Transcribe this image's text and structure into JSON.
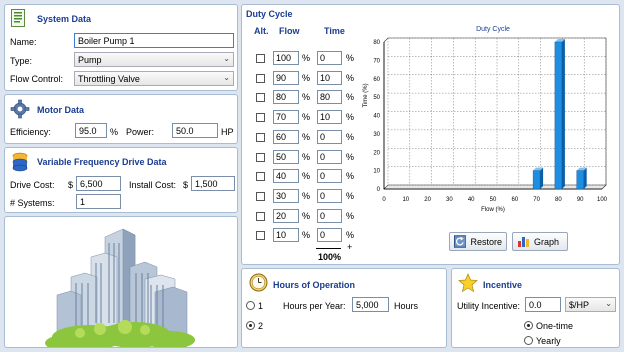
{
  "system": {
    "title": "System Data",
    "name_label": "Name:",
    "name_value": "Boiler Pump 1",
    "type_label": "Type:",
    "type_value": "Pump",
    "flow_control_label": "Flow Control:",
    "flow_control_value": "Throttling Valve"
  },
  "motor": {
    "title": "Motor Data",
    "efficiency_label": "Efficiency:",
    "efficiency_value": "95.0",
    "efficiency_unit": "%",
    "power_label": "Power:",
    "power_value": "50.0",
    "power_unit": "HP"
  },
  "vfd": {
    "title": "Variable Frequency Drive Data",
    "drive_cost_label": "Drive Cost:",
    "drive_cost_currency": "$",
    "drive_cost_value": "6,500",
    "install_cost_label": "Install Cost:",
    "install_cost_currency": "$",
    "install_cost_value": "1,500",
    "systems_label": "# Systems:",
    "systems_value": "1"
  },
  "duty": {
    "title": "Duty Cycle",
    "col_alt": "Alt.",
    "col_flow": "Flow",
    "col_time": "Time",
    "pct": "%",
    "rows": [
      {
        "flow": "100",
        "time": "0"
      },
      {
        "flow": "90",
        "time": "10"
      },
      {
        "flow": "80",
        "time": "80"
      },
      {
        "flow": "70",
        "time": "10"
      },
      {
        "flow": "60",
        "time": "0"
      },
      {
        "flow": "50",
        "time": "0"
      },
      {
        "flow": "40",
        "time": "0"
      },
      {
        "flow": "30",
        "time": "0"
      },
      {
        "flow": "20",
        "time": "0"
      },
      {
        "flow": "10",
        "time": "0"
      }
    ],
    "total": "100%",
    "plus": "+",
    "restore_label": "Restore",
    "graph_label": "Graph"
  },
  "chart_data": {
    "type": "bar",
    "title": "Duty Cycle",
    "xlabel": "Flow (%)",
    "ylabel": "Time (%)",
    "x_ticks": [
      "0",
      "10",
      "20",
      "30",
      "40",
      "50",
      "60",
      "70",
      "80",
      "90",
      "100"
    ],
    "y_ticks": [
      "0",
      "10",
      "20",
      "30",
      "40",
      "50",
      "60",
      "70",
      "80"
    ],
    "ylim": [
      0,
      80
    ],
    "xlim": [
      0,
      100
    ],
    "points": [
      {
        "x": 10,
        "y": 0
      },
      {
        "x": 20,
        "y": 0
      },
      {
        "x": 30,
        "y": 0
      },
      {
        "x": 40,
        "y": 0
      },
      {
        "x": 50,
        "y": 0
      },
      {
        "x": 60,
        "y": 0
      },
      {
        "x": 70,
        "y": 10
      },
      {
        "x": 80,
        "y": 80
      },
      {
        "x": 90,
        "y": 10
      },
      {
        "x": 100,
        "y": 0
      }
    ],
    "grid": true,
    "bar_color": "#1e8fe0"
  },
  "hours": {
    "title": "Hours of Operation",
    "opt1": "1",
    "opt2": "2",
    "per_year_label": "Hours per Year:",
    "per_year_value": "5,000",
    "unit": "Hours"
  },
  "incentive": {
    "title": "Incentive",
    "utility_label": "Utility Incentive:",
    "utility_value": "0.0",
    "unit_value": "$/HP",
    "onetime_label": "One-time",
    "yearly_label": "Yearly"
  },
  "colors": {
    "accent": "#1a3d8f",
    "panel_border": "#a9bcd2",
    "background": "#dde6f0"
  }
}
